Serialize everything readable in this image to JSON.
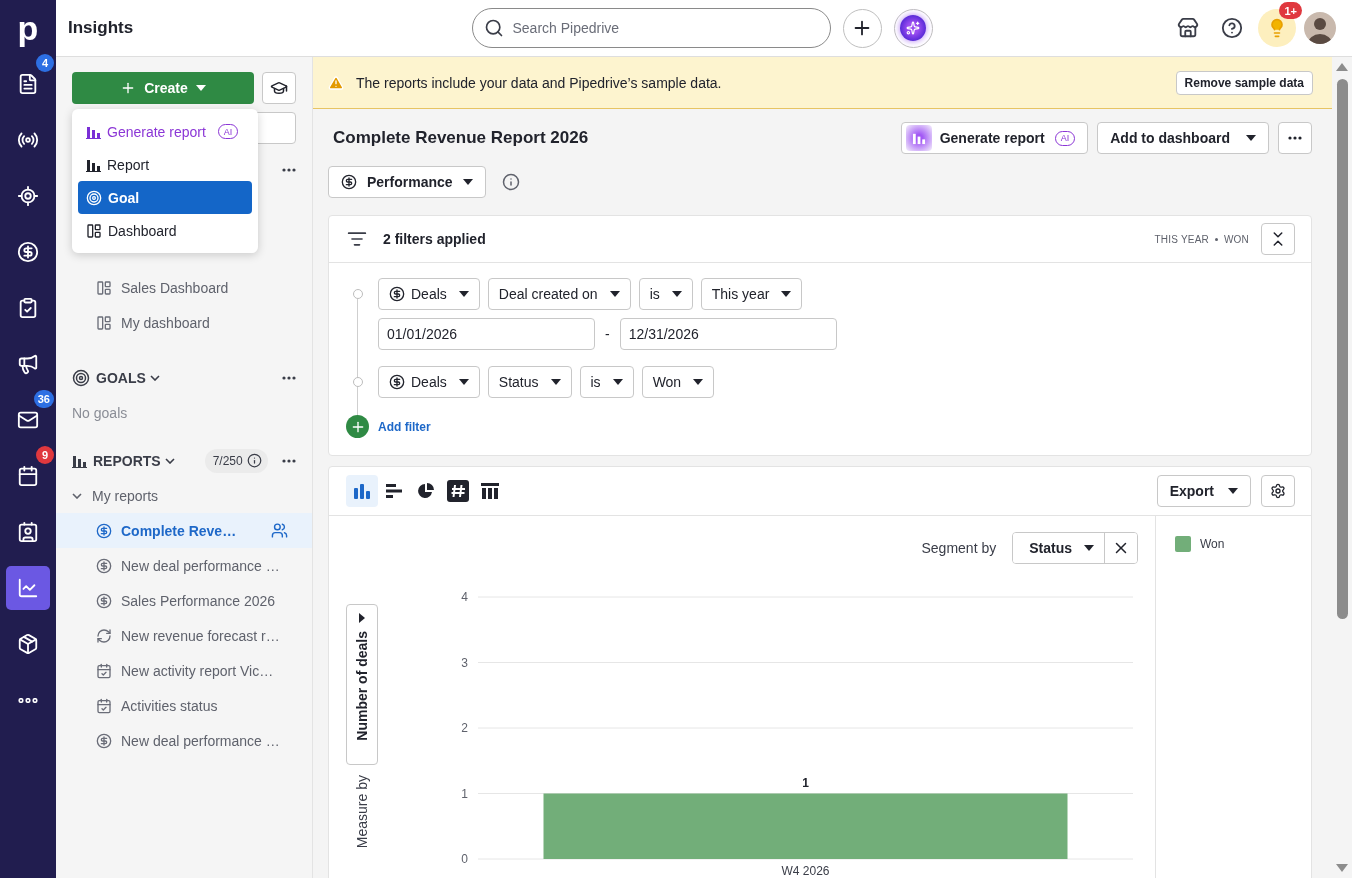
{
  "rail": {
    "logo": "p",
    "items": [
      {
        "selected": false,
        "badge": {
          "text": "4",
          "color": "#2d6fe3"
        }
      },
      {
        "selected": false
      },
      {
        "selected": false
      },
      {
        "selected": false
      },
      {
        "selected": false
      },
      {
        "selected": false
      },
      {
        "selected": false,
        "badge": {
          "text": "36",
          "color": "#2d6fe3"
        }
      },
      {
        "selected": false,
        "badge": {
          "text": "9",
          "color": "#e0383e"
        }
      },
      {
        "selected": false
      },
      {
        "selected": true
      },
      {
        "selected": false
      },
      {
        "selected": false
      }
    ]
  },
  "header": {
    "title": "Insights",
    "search": {
      "placeholder": "Search Pipedrive"
    },
    "notification_badge": "1+"
  },
  "sidebar": {
    "create_button": "Create",
    "create_menu": [
      {
        "label": "Generate report",
        "kind": "ai",
        "badge": "AI",
        "selected": false
      },
      {
        "label": "Report",
        "kind": "report",
        "selected": false
      },
      {
        "label": "Goal",
        "kind": "goal",
        "selected": true
      },
      {
        "label": "Dashboard",
        "kind": "dashboard",
        "selected": false
      }
    ],
    "dashboards": [
      "Sales Dashboard",
      "My dashboard"
    ],
    "goals": {
      "title": "GOALS",
      "empty": "No goals"
    },
    "reports": {
      "title": "REPORTS",
      "count": "7/250",
      "folder": {
        "label": "My reports",
        "expanded": true
      },
      "items": [
        {
          "label": "Complete Reve…",
          "kind": "deals",
          "selected": true,
          "shared": true
        },
        {
          "label": "New deal performance …",
          "kind": "deals",
          "selected": false,
          "shared": false
        },
        {
          "label": "Sales Performance 2026",
          "kind": "deals",
          "selected": false,
          "shared": false
        },
        {
          "label": "New revenue forecast r…",
          "kind": "forecast",
          "selected": false,
          "shared": false
        },
        {
          "label": "New activity report Vic…",
          "kind": "activity",
          "selected": false,
          "shared": false
        },
        {
          "label": "Activities status",
          "kind": "activity",
          "selected": false,
          "shared": false
        },
        {
          "label": "New deal performance …",
          "kind": "deals",
          "selected": false,
          "shared": false
        }
      ]
    }
  },
  "banner": {
    "text": "The reports include your data and Pipedrive’s sample data.",
    "button": "Remove sample data"
  },
  "report": {
    "title": "Complete Revenue Report 2026",
    "generate_button": {
      "label": "Generate report",
      "badge": "AI"
    },
    "add_button": "Add to dashboard",
    "view_select": "Performance"
  },
  "filters": {
    "summary": "2 filters applied",
    "tags": [
      "THIS YEAR",
      "WON"
    ],
    "add_filter": "Add filter",
    "rows": [
      {
        "kind": "condition",
        "selects": [
          "Deals",
          "Deal created on",
          "is",
          "This year"
        ]
      },
      {
        "kind": "range",
        "from": "01/01/2026",
        "separator": "-",
        "to": "12/31/2026"
      },
      {
        "kind": "condition",
        "selects": [
          "Deals",
          "Status",
          "is",
          "Won"
        ]
      }
    ]
  },
  "chart": {
    "types": [
      {
        "kind": "column",
        "selected": true
      },
      {
        "kind": "bar",
        "selected": false
      },
      {
        "kind": "pie",
        "selected": false
      },
      {
        "kind": "number",
        "selected": false
      },
      {
        "kind": "table",
        "selected": false
      }
    ],
    "export": "Export",
    "segment": {
      "label": "Segment by",
      "value": "Status"
    },
    "measure": {
      "label": "Measure by",
      "value": "Number of deals"
    },
    "chart_data": {
      "type": "bar",
      "categories": [
        "W4 2026"
      ],
      "series": [
        {
          "name": "Won",
          "color": "#72ae79",
          "values": [
            1
          ]
        }
      ],
      "ylim": [
        0,
        4
      ],
      "yticks": [
        0,
        1,
        2,
        3,
        4
      ],
      "grid": true,
      "data_labels": true
    }
  }
}
